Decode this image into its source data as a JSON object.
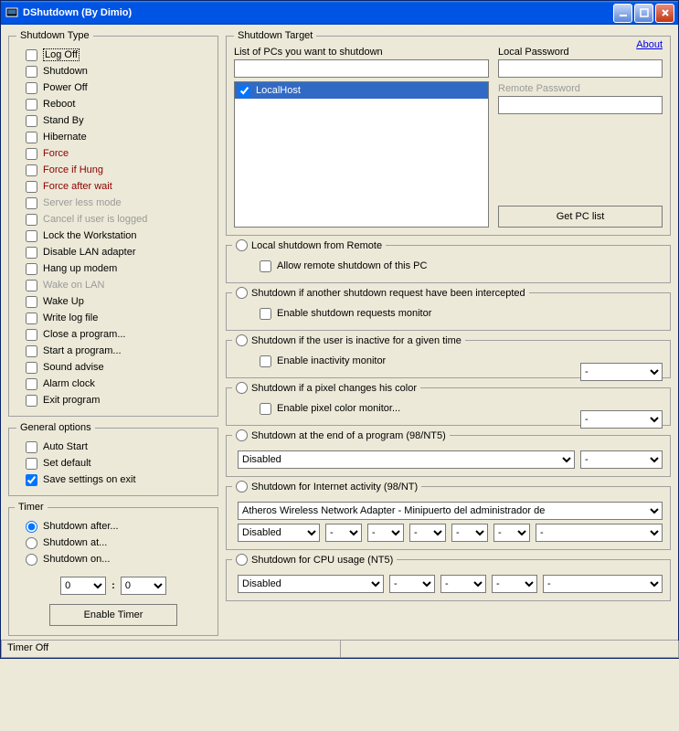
{
  "window": {
    "title": "DShutdown (By Dimio)"
  },
  "about_label": "About",
  "shutdown_type": {
    "legend": "Shutdown Type",
    "items": [
      {
        "label": "Log Off",
        "cls": ""
      },
      {
        "label": "Shutdown",
        "cls": ""
      },
      {
        "label": "Power Off",
        "cls": ""
      },
      {
        "label": "Reboot",
        "cls": ""
      },
      {
        "label": "Stand By",
        "cls": ""
      },
      {
        "label": "Hibernate",
        "cls": ""
      },
      {
        "label": "Force",
        "cls": "red"
      },
      {
        "label": "Force if Hung",
        "cls": "red"
      },
      {
        "label": "Force after wait",
        "cls": "red"
      },
      {
        "label": "Server less mode",
        "cls": "gray"
      },
      {
        "label": "Cancel if user is logged",
        "cls": "gray"
      },
      {
        "label": "Lock the Workstation",
        "cls": ""
      },
      {
        "label": "Disable LAN adapter",
        "cls": ""
      },
      {
        "label": "Hang up modem",
        "cls": ""
      },
      {
        "label": "Wake on LAN",
        "cls": "gray"
      },
      {
        "label": "Wake Up",
        "cls": ""
      },
      {
        "label": "Write log file",
        "cls": ""
      },
      {
        "label": "Close a program...",
        "cls": ""
      },
      {
        "label": "Start a program...",
        "cls": ""
      },
      {
        "label": "Sound advise",
        "cls": ""
      },
      {
        "label": "Alarm clock",
        "cls": ""
      },
      {
        "label": "Exit program",
        "cls": ""
      }
    ]
  },
  "general": {
    "legend": "General options",
    "auto_start": "Auto Start",
    "set_default": "Set default",
    "save_on_exit": "Save settings on exit"
  },
  "timer": {
    "legend": "Timer",
    "after": "Shutdown after...",
    "at": "Shutdown at...",
    "on": "Shutdown on...",
    "val1": "0",
    "val2": "0",
    "sep": ":",
    "enable": "Enable Timer"
  },
  "target": {
    "legend": "Shutdown Target",
    "list_label": "List of PCs you want to shutdown",
    "local_pw_label": "Local Password",
    "remote_pw_label": "Remote Password",
    "localhost": "LocalHost",
    "get_list": "Get PC list"
  },
  "remote": {
    "legend": "Local shutdown from Remote",
    "allow": "Allow remote shutdown of this PC"
  },
  "intercept": {
    "legend": "Shutdown if another shutdown request have been intercepted",
    "enable": "Enable shutdown requests monitor"
  },
  "inactive": {
    "legend": "Shutdown if the user is inactive for a given time",
    "enable": "Enable inactivity monitor",
    "sel": "-"
  },
  "pixel": {
    "legend": "Shutdown if a pixel changes his color",
    "enable": "Enable pixel color monitor...",
    "sel": "-"
  },
  "prog_end": {
    "legend": "Shutdown at the end of a program (98/NT5)",
    "disabled": "Disabled",
    "sel": "-"
  },
  "internet": {
    "legend": "Shutdown for Internet activity (98/NT)",
    "adapter": "Atheros Wireless Network Adapter - Minipuerto del administrador de",
    "disabled": "Disabled",
    "s": "-"
  },
  "cpu": {
    "legend": "Shutdown for CPU usage (NT5)",
    "disabled": "Disabled",
    "s": "-"
  },
  "status": {
    "cell1": "Timer Off",
    "cell2": ""
  }
}
